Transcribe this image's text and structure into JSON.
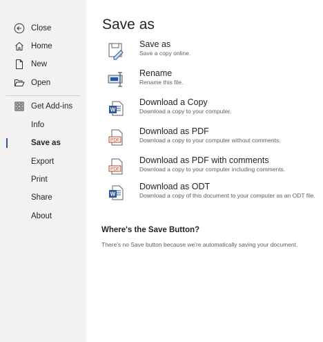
{
  "sidebar": {
    "items": [
      {
        "label": "Close",
        "icon": "back-arrow-icon"
      },
      {
        "label": "Home",
        "icon": "home-icon"
      },
      {
        "label": "New",
        "icon": "new-document-icon"
      },
      {
        "label": "Open",
        "icon": "folder-open-icon"
      },
      {
        "label": "Get Add-ins",
        "icon": "add-ins-icon"
      },
      {
        "label": "Info"
      },
      {
        "label": "Save as",
        "active": true
      },
      {
        "label": "Export"
      },
      {
        "label": "Print"
      },
      {
        "label": "Share"
      },
      {
        "label": "About"
      }
    ]
  },
  "main": {
    "title": "Save as",
    "options": [
      {
        "title": "Save as",
        "description": "Save a copy online.",
        "icon": "save-as-icon"
      },
      {
        "title": "Rename",
        "description": "Rename this file.",
        "icon": "rename-icon"
      },
      {
        "title": "Download a Copy",
        "description": "Download a copy to your computer.",
        "icon": "word-document-icon"
      },
      {
        "title": "Download as PDF",
        "description": "Download a copy to your computer without comments.",
        "icon": "pdf-icon"
      },
      {
        "title": "Download as PDF with comments",
        "description": "Download a copy to your computer including comments.",
        "icon": "pdf-icon"
      },
      {
        "title": "Download as ODT",
        "description": "Download a copy of this document to your computer as an ODT file.",
        "icon": "word-document-icon"
      }
    ],
    "save_button_info": {
      "title": "Where's the Save Button?",
      "description": "There's no Save button because we're automatically saving your document."
    }
  },
  "colors": {
    "accent": "#2b579a",
    "sidebar_bg": "#f3f2f1",
    "pdf_red": "#c43e1c"
  }
}
